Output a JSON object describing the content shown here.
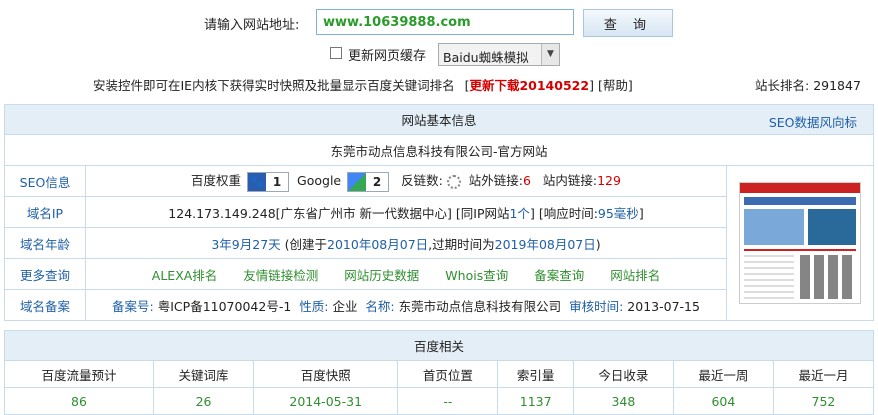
{
  "search": {
    "label": "请输入网站地址:",
    "value": "www.10639888.com",
    "button": "查 询",
    "cache_label": "更新网页缓存",
    "spider_option": "Baidu蜘蛛模拟"
  },
  "promo": {
    "text": "安装控件即可在IE内核下获得实时快照及批量显示百度关键词排名",
    "download_open": "[",
    "download": "更新下载20140522",
    "sep": "]",
    "help": "[帮助]",
    "rank_label": "站长排名:",
    "rank_value": "291847"
  },
  "basic": {
    "title": "网站基本信息",
    "seo_link": "SEO数据风向标",
    "site_name": "东莞市动点信息科技有限公司-官方网站",
    "rows": {
      "seo": {
        "label": "SEO信息",
        "baidu_weight": "百度权重",
        "baidu_value": "1",
        "google": "Google",
        "google_value": "2",
        "backlinks": "反链数:",
        "external": "站外链接:",
        "external_value": "6",
        "internal": "站内链接:",
        "internal_value": "129"
      },
      "ip": {
        "label": "域名IP",
        "value": "124.173.149.248[广东省广州市 新一代数据中心]",
        "same_ip": "[同IP网站",
        "same_ip_value": "1个",
        "same_ip_close": "]",
        "resp": "[响应时间:",
        "resp_value": "95毫秒",
        "resp_close": "]"
      },
      "age": {
        "label": "域名年龄",
        "value": "3年9月27天",
        "created": "(创建于",
        "created_date": "2010年08月07日",
        "expire": ",过期时间为",
        "expire_date": "2019年08月07日",
        "close": ")"
      },
      "more": {
        "label": "更多查询",
        "links": [
          "ALEXA排名",
          "友情链接检测",
          "网站历史数据",
          "Whois查询",
          "备案查询",
          "网站排名"
        ]
      },
      "icp": {
        "label": "域名备案",
        "icp_label": "备案号:",
        "icp_value": "粤ICP备11070042号-1",
        "nature_label": "性质:",
        "nature_value": "企业",
        "name_label": "名称:",
        "name_value": "东莞市动点信息科技有限公司",
        "date_label": "审核时间:",
        "date_value": "2013-07-15"
      }
    }
  },
  "baidu": {
    "title": "百度相关",
    "headers": [
      "百度流量预计",
      "关键词库",
      "百度快照",
      "首页位置",
      "索引量",
      "今日收录",
      "最近一周",
      "最近一月"
    ],
    "values": [
      "86",
      "26",
      "2014-05-31",
      "--",
      "1137",
      "348",
      "604",
      "752"
    ]
  },
  "colors": {
    "accent": "#1f5fa8",
    "highlight": "#d40000",
    "value_green": "#2f8f2f",
    "header_bg": "#e4eef7"
  }
}
